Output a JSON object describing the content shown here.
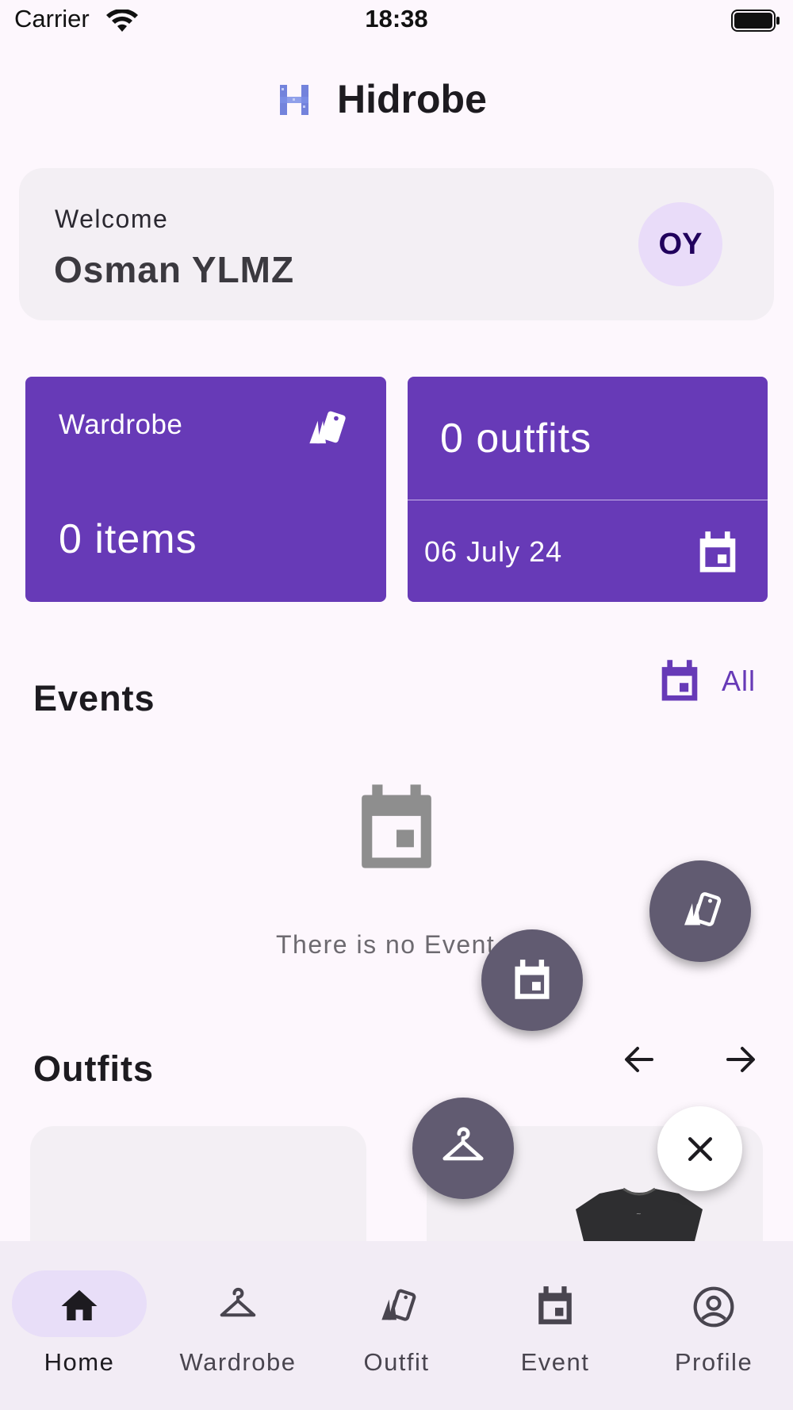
{
  "status_bar": {
    "carrier": "Carrier",
    "time": "18:38"
  },
  "app_bar": {
    "title": "Hidrobe"
  },
  "welcome": {
    "label": "Welcome",
    "name": "Osman YLMZ",
    "initials": "OY"
  },
  "stats": {
    "wardrobe_title": "Wardrobe",
    "wardrobe_count": "0 items",
    "outfits_count": "0 outfits",
    "date": "06 July 24"
  },
  "events": {
    "title": "Events",
    "all_label": "All",
    "empty_text": "There is no Event"
  },
  "outfits": {
    "title": "Outfits"
  },
  "bottom_nav": {
    "items": [
      {
        "label": "Home",
        "icon": "home-icon",
        "active": true
      },
      {
        "label": "Wardrobe",
        "icon": "hanger-icon",
        "active": false
      },
      {
        "label": "Outfit",
        "icon": "outfit-tags-icon",
        "active": false
      },
      {
        "label": "Event",
        "icon": "calendar-icon",
        "active": false
      },
      {
        "label": "Profile",
        "icon": "account-circle-icon",
        "active": false
      }
    ]
  },
  "colors": {
    "primary": "#673ab7",
    "background": "#fdf7fd",
    "fab": "#615b71",
    "card": "#f3eff4",
    "nav_indicator": "#e8def8"
  }
}
